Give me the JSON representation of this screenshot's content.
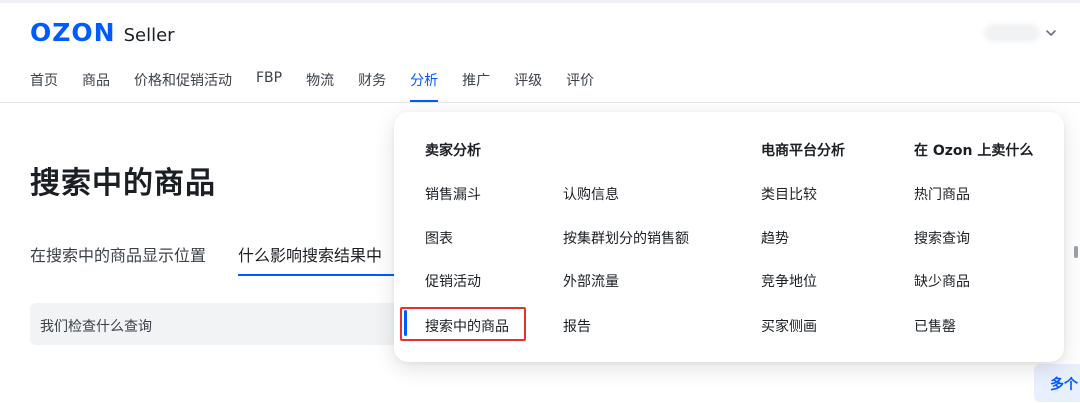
{
  "brand": {
    "logo_main": "OZON",
    "logo_sub": "Seller",
    "accent": "#005bff"
  },
  "nav": {
    "items": [
      {
        "label": "首页"
      },
      {
        "label": "商品"
      },
      {
        "label": "价格和促销活动"
      },
      {
        "label": "FBP"
      },
      {
        "label": "物流"
      },
      {
        "label": "财务"
      },
      {
        "label": "分析",
        "active": true
      },
      {
        "label": "推广"
      },
      {
        "label": "评级"
      },
      {
        "label": "评价"
      }
    ]
  },
  "page": {
    "title": "搜索中的商品",
    "tabs": [
      {
        "label": "在搜索中的商品显示位置"
      },
      {
        "label": "什么影响搜索结果中",
        "active": true
      }
    ],
    "query_label": "我们检查什么查询",
    "more_label": "多个"
  },
  "dropdown": {
    "seller_analytics": {
      "heading": "卖家分析",
      "col1": [
        "销售漏斗",
        "图表",
        "促销活动",
        "搜索中的商品"
      ],
      "col2": [
        "认购信息",
        "按集群划分的销售额",
        "外部流量",
        "报告"
      ]
    },
    "platform_analytics": {
      "heading": "电商平台分析",
      "items": [
        "类目比较",
        "趋势",
        "竞争地位",
        "买家侧画"
      ]
    },
    "what_to_sell": {
      "heading": "在 Ozon 上卖什么",
      "items": [
        "热门商品",
        "搜索查询",
        "缺少商品",
        "已售罄"
      ]
    },
    "selected_item": "搜索中的商品",
    "highlight_color": "#e4332c"
  }
}
